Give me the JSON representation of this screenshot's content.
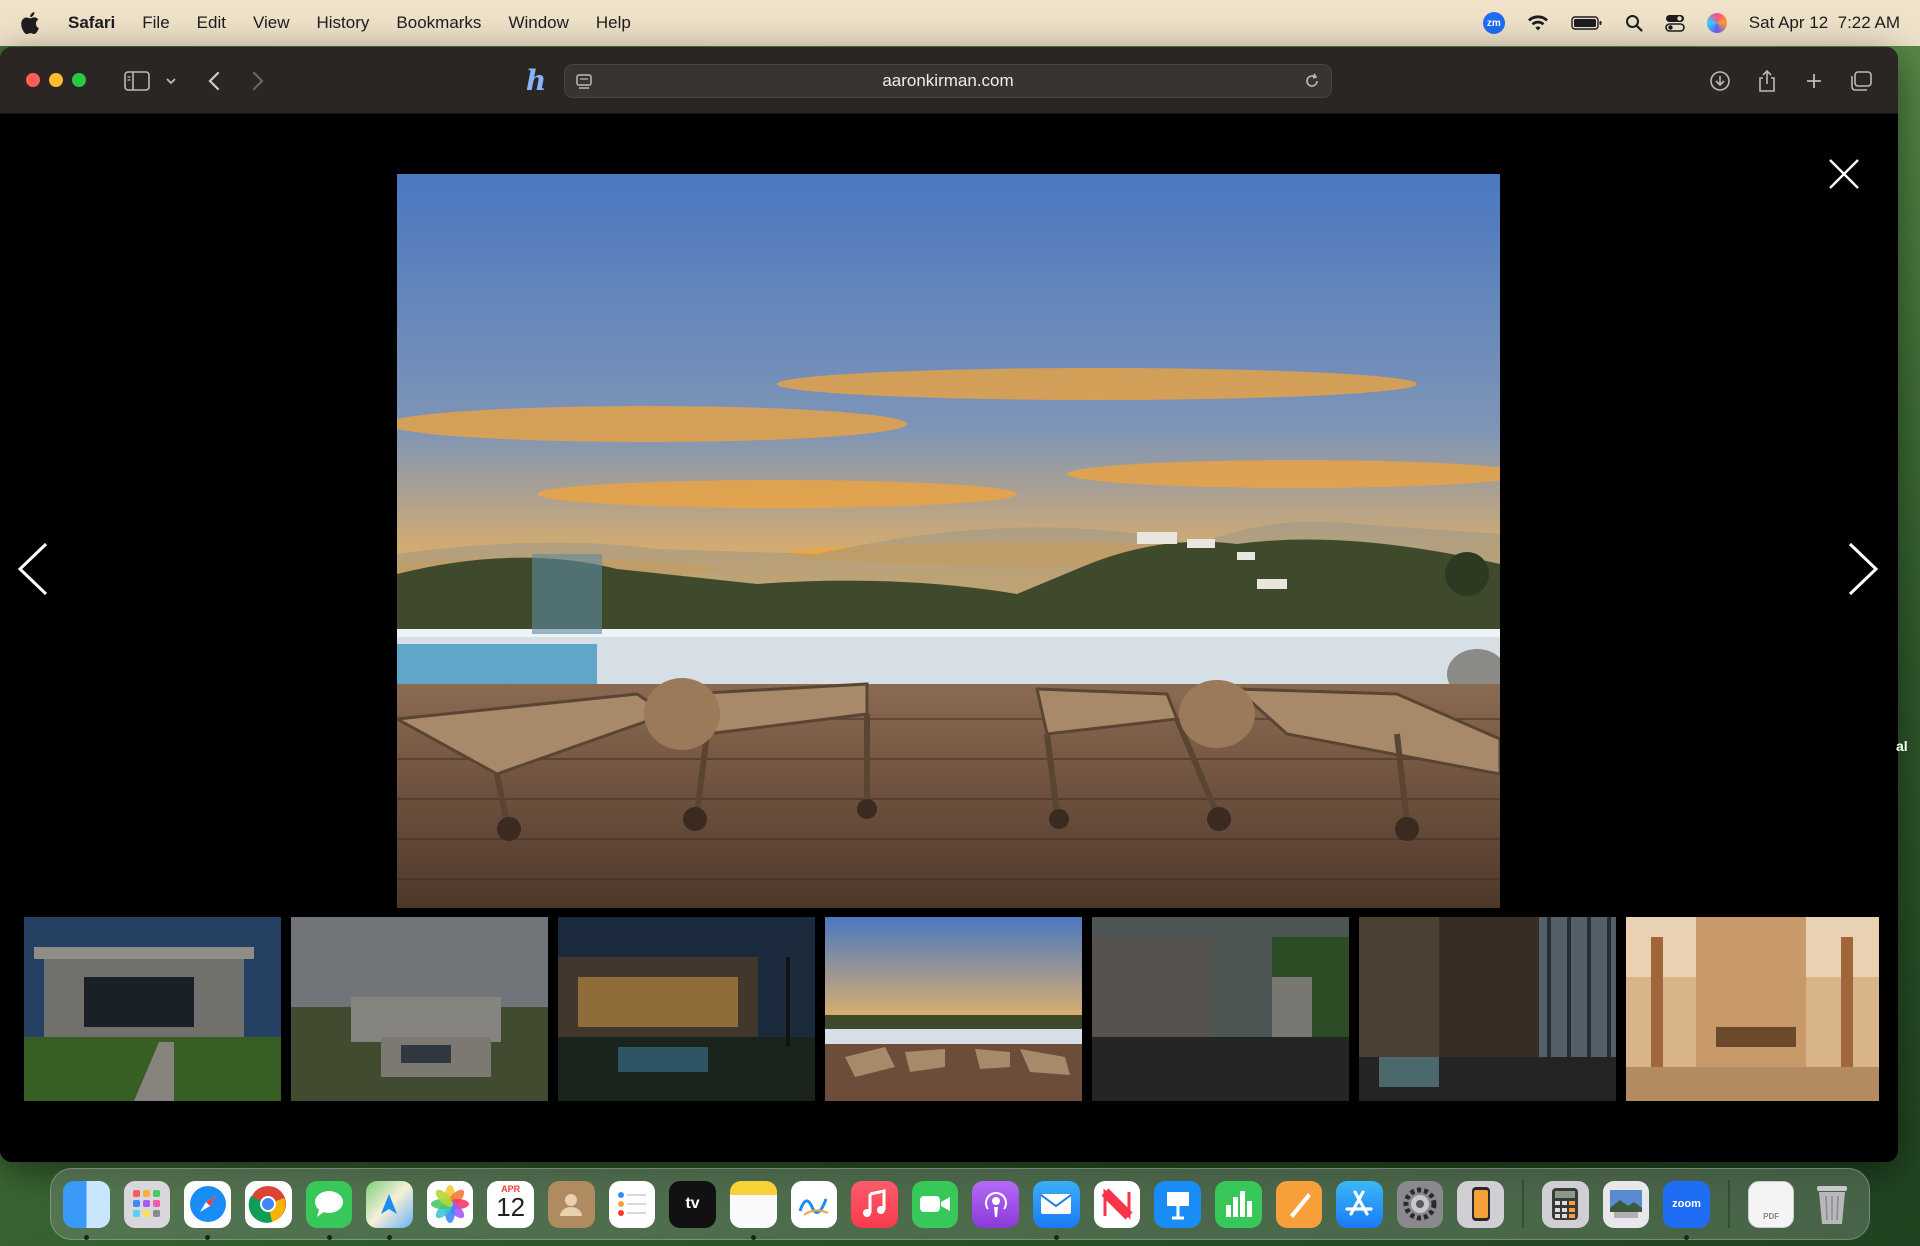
{
  "menubar": {
    "app_name": "Safari",
    "items": [
      "File",
      "Edit",
      "View",
      "History",
      "Bookmarks",
      "Window",
      "Help"
    ],
    "zoom_badge": "zm",
    "datetime": "Sat Apr 12  7:22 AM"
  },
  "browser": {
    "url": "aaronkirman.com",
    "extension_glyph": "h"
  },
  "gallery": {
    "thumbnail_count": 7,
    "selected_index": 3,
    "side_text": "al"
  },
  "dock": {
    "calendar_month": "APR",
    "calendar_day": "12",
    "tv_label": "tv",
    "zoom_label": "zoom",
    "pdf_label": "PDF",
    "apps": [
      "Finder",
      "Launchpad",
      "Safari",
      "Chrome",
      "Messages",
      "Maps",
      "Photos",
      "Calendar",
      "Contacts",
      "Reminders",
      "TV",
      "Notes",
      "Freeform",
      "Music",
      "FaceTime",
      "Podcasts",
      "Mail",
      "News",
      "Keynote",
      "Numbers",
      "Pages",
      "App Store",
      "System Settings",
      "iPhone Mirroring",
      "Calculator",
      "Preview",
      "Zoom",
      "Document",
      "Trash"
    ]
  },
  "colors": {
    "menubar_bg": "#efe2c9",
    "toolbar_bg": "#2b2623",
    "sky_top": "#4a78c0",
    "sunset_orange": "#f2a43a",
    "deck_wood": "#6b4d3a"
  }
}
